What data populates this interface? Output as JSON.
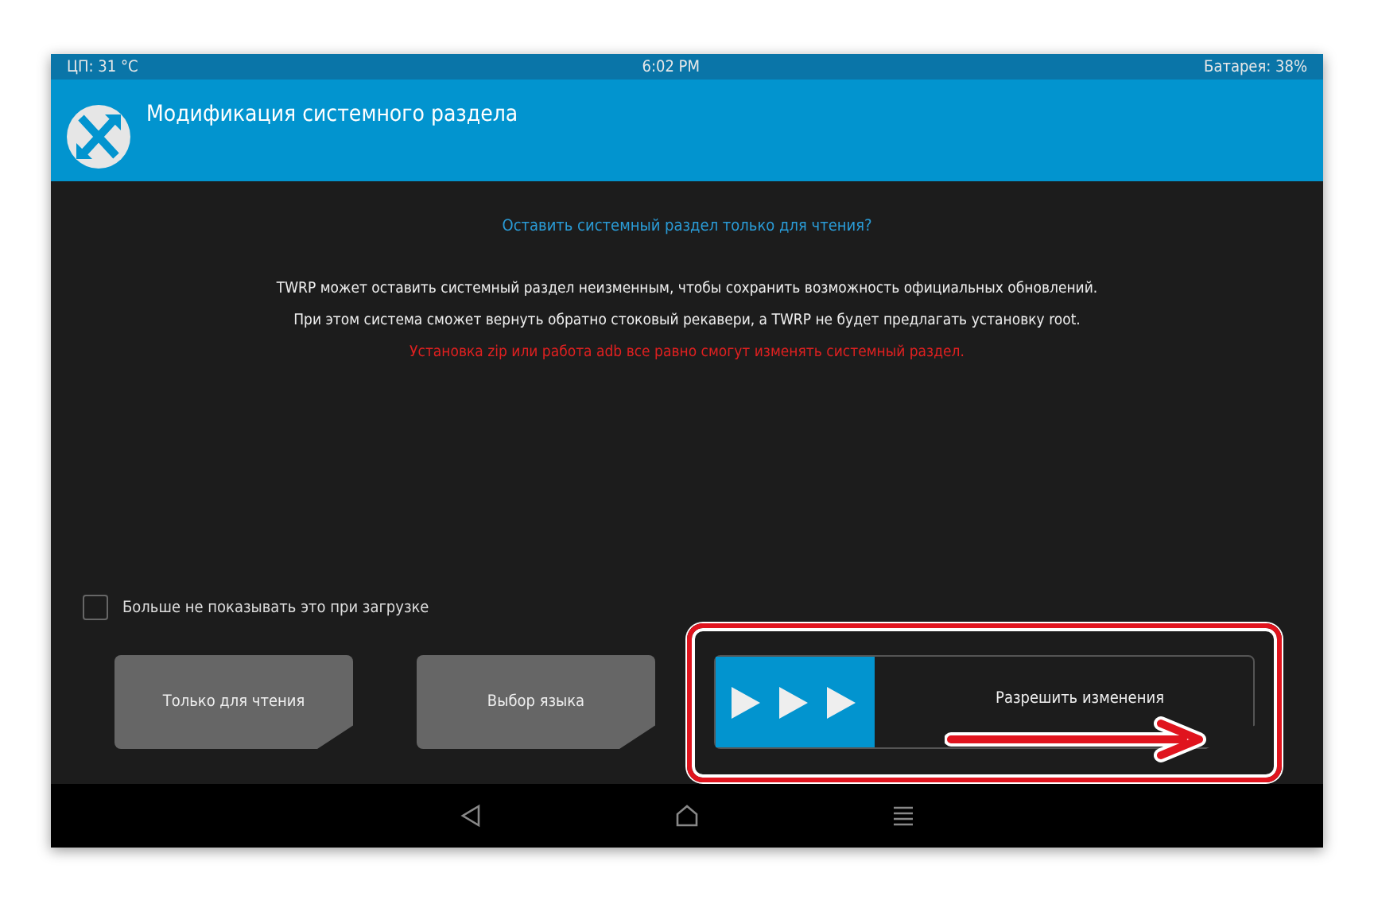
{
  "status_bar": {
    "cpu": "ЦП: 31 °C",
    "time": "6:02 PM",
    "battery": "Батарея: 38%"
  },
  "header": {
    "title": "Модификация системного раздела"
  },
  "prompt": "Оставить системный раздел только для чтения?",
  "messages": [
    {
      "text": "TWRP может оставить системный раздел неизменным, чтобы сохранить возможность официальных обновлений.",
      "kind": "info"
    },
    {
      "text": "При этом система сможет вернуть обратно стоковый рекавери, а TWRP не будет предлагать установку root.",
      "kind": "info"
    },
    {
      "text": "Установка zip или работа adb все равно смогут изменять системный раздел.",
      "kind": "warning"
    }
  ],
  "checkbox": {
    "label": "Больше не показывать это при загрузке",
    "checked": false
  },
  "buttons": [
    "Только для чтения",
    "Выбор языка"
  ],
  "swipe_slider": {
    "label": "Разрешить изменения",
    "level": 0
  },
  "annotation": {
    "highlighted": true
  }
}
